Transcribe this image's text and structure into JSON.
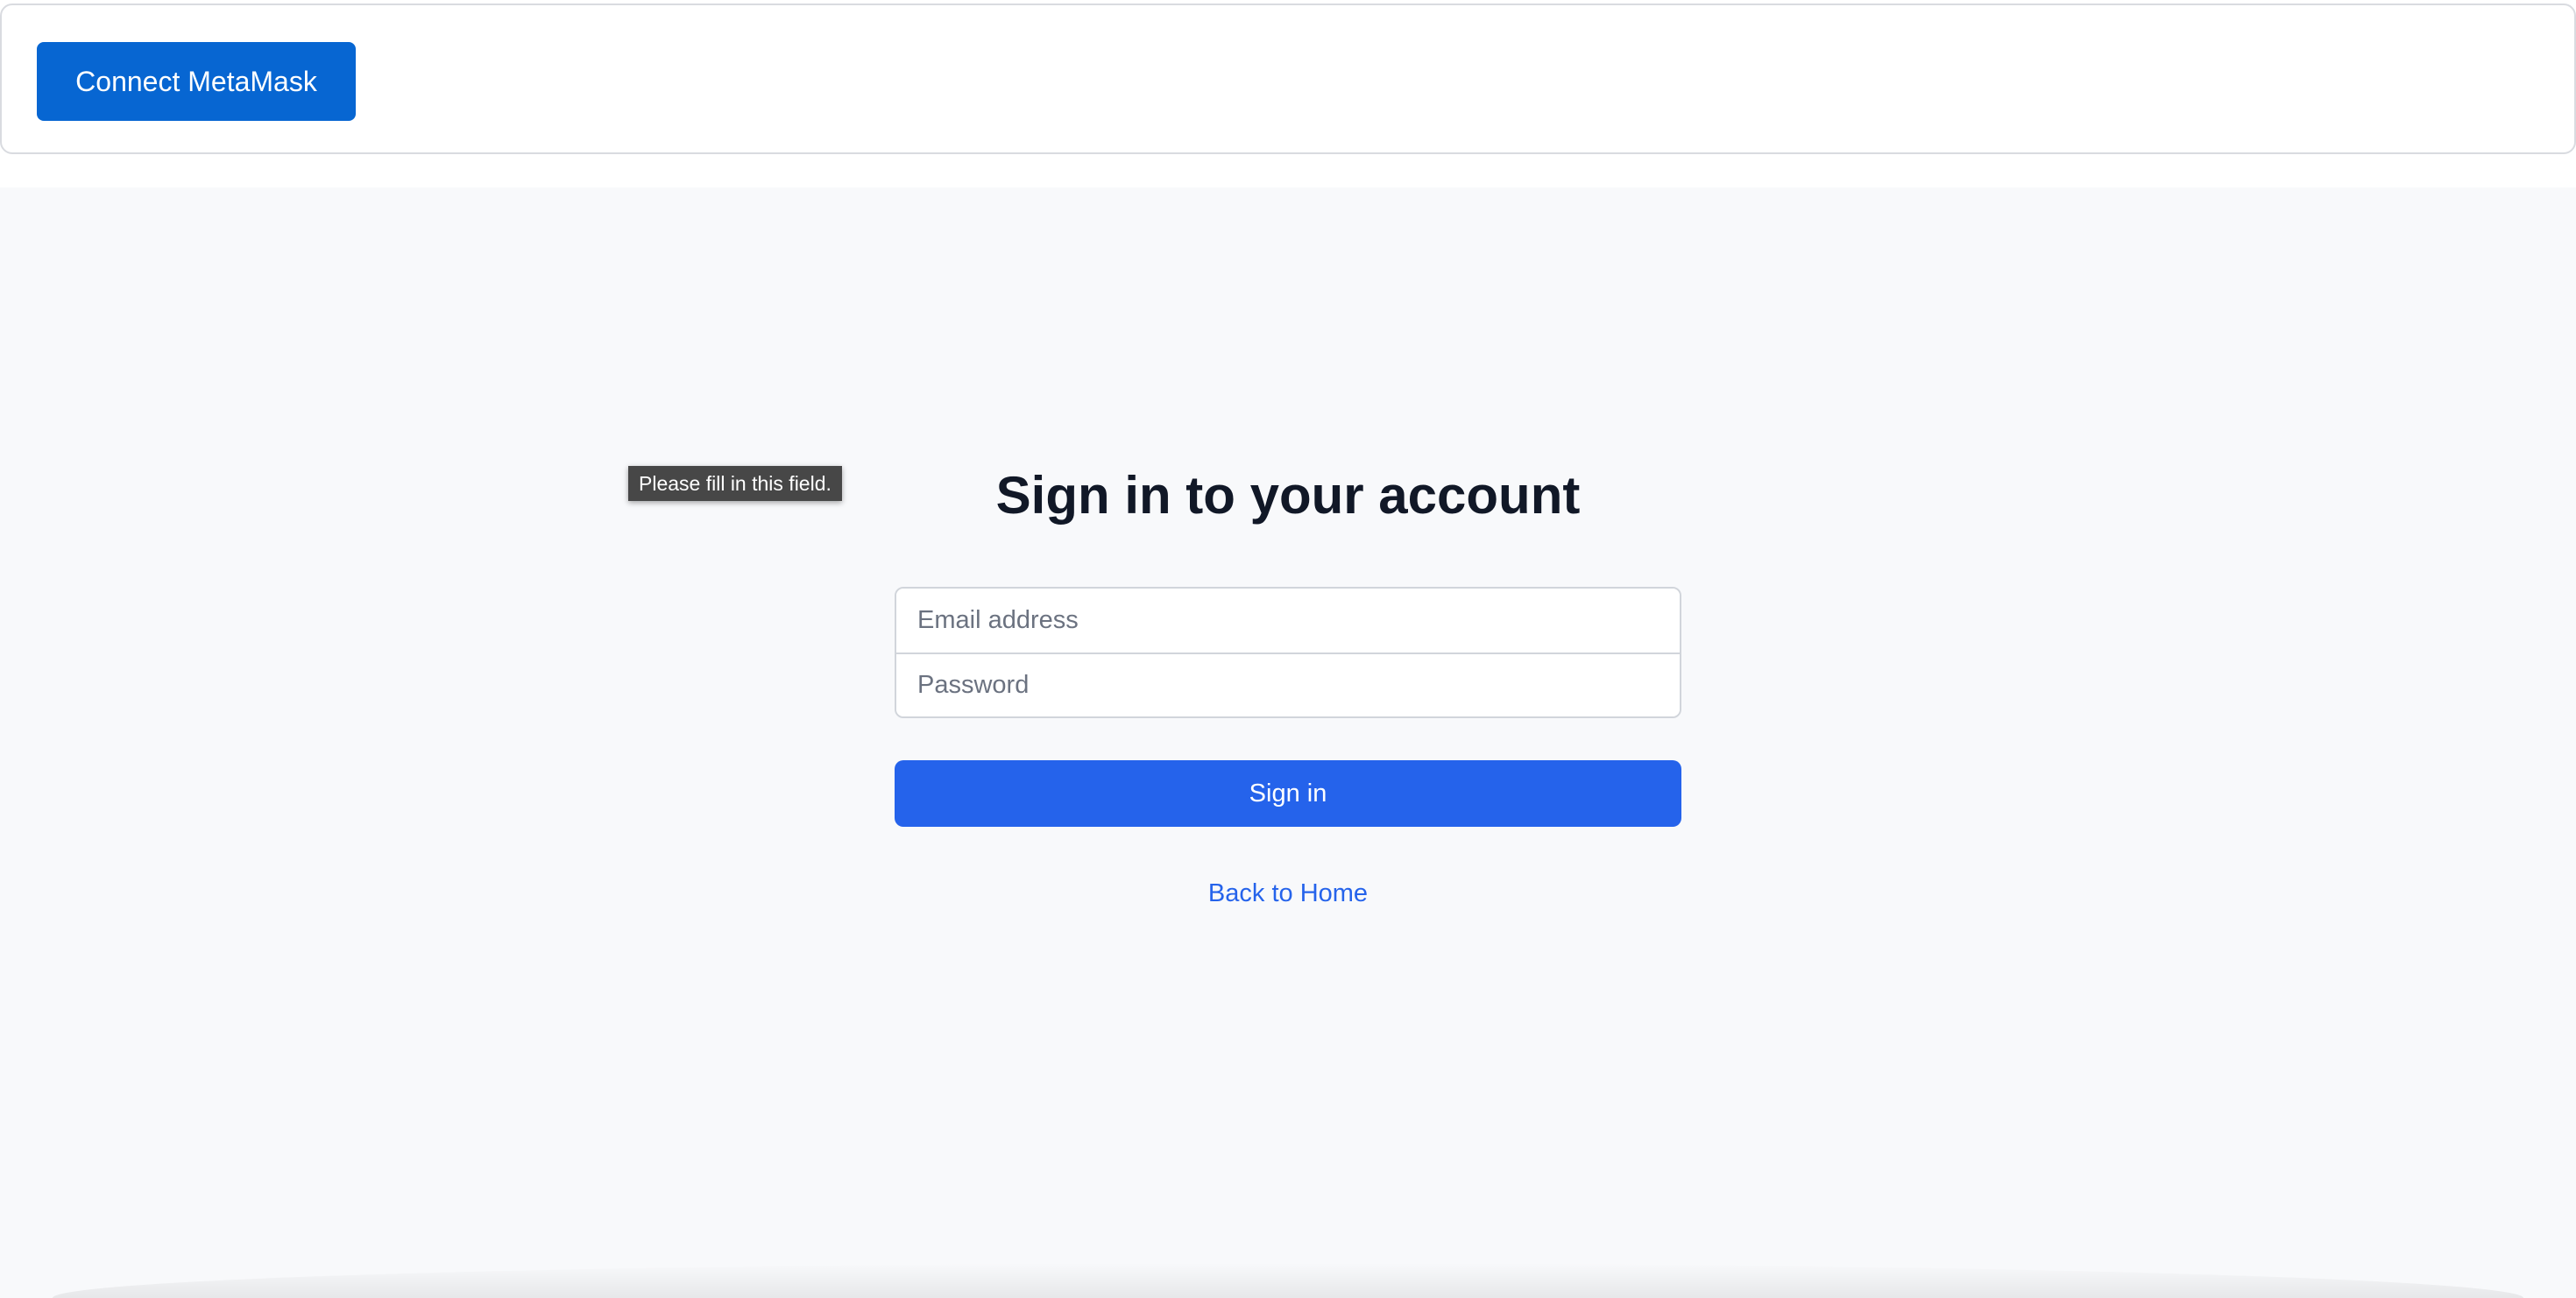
{
  "header": {
    "connect_label": "Connect MetaMask"
  },
  "signin": {
    "title": "Sign in to your account",
    "email": {
      "value": "",
      "placeholder": "Email address"
    },
    "password": {
      "value": "",
      "placeholder": "Password"
    },
    "submit_label": "Sign in",
    "back_link_label": "Back to Home"
  },
  "validation_tooltip": {
    "text": "Please fill in this field."
  },
  "colors": {
    "connect_button": "#0766d2",
    "signin_button": "#2563eb",
    "link": "#2563eb",
    "page_background": "#f8f9fb",
    "title_text": "#111827",
    "tooltip_background": "#474747"
  }
}
